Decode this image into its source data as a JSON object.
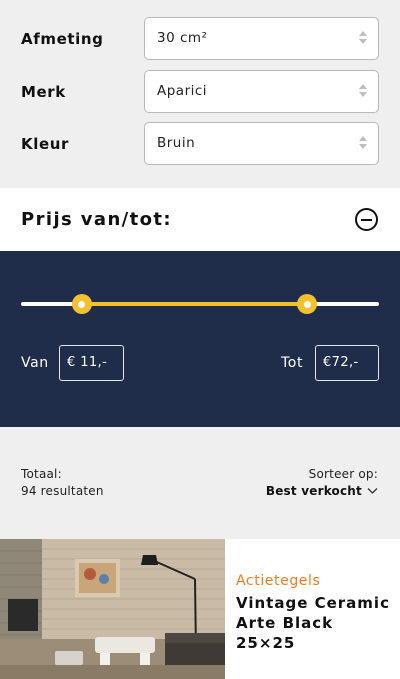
{
  "filters": [
    {
      "label": "Afmeting",
      "value": "30 cm²"
    },
    {
      "label": "Merk",
      "value": "Aparici"
    },
    {
      "label": "Kleur",
      "value": "Bruin"
    }
  ],
  "price": {
    "title": "Prijs van/tot:",
    "from_label": "Van",
    "from_value": "€ 11,-",
    "to_label": "Tot",
    "to_value": "€72,-",
    "slider_low_fraction": 0.17,
    "slider_high_fraction": 0.8
  },
  "results": {
    "total_label": "Totaal:",
    "total_count": "94 resultaten",
    "sort_label": "Sorteer op:",
    "sort_value": "Best verkocht"
  },
  "product": {
    "category": "Actietegels",
    "name": "Vintage Ceramic Arte Black 25×25"
  },
  "colors": {
    "accent": "#f2c12e",
    "panel": "#1f2d4b",
    "category": "#f07b1d"
  }
}
